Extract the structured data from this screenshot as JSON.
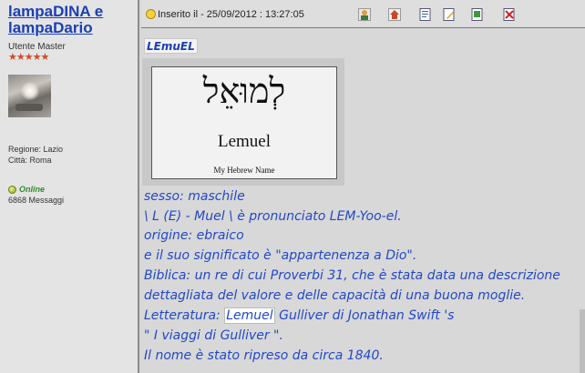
{
  "author": {
    "name": "lampaDINA e lampaDario",
    "rank": "Utente Master",
    "stars": "★★★★★",
    "region_label": "Regione: Lazio",
    "city_label": "Città: Roma",
    "status": "Online",
    "messages": "6868 Messaggi"
  },
  "post": {
    "posted_label": "Inserito il - 25/09/2012 : 13:27:05",
    "toolbar_icons": [
      "profile-icon",
      "home-icon",
      "quote-icon",
      "edit-icon",
      "reply-icon",
      "delete-icon"
    ],
    "name_tag": "LEmuEL",
    "image": {
      "hebrew": "לְמוּאֵל",
      "latin": "Lemuel",
      "caption": "My Hebrew Name"
    },
    "lines": [
      "sesso: maschile",
      "\\ L (E) - Muel \\ è pronunciato LEM-Yoo-el.",
      "origine: ebraico",
      "e il suo significato è \"appartenenza a Dio\".",
      "Biblica: un re di cui Proverbi 31, che è stata data una descrizione",
      "dettagliata del valore e delle capacità di una buona moglie."
    ],
    "lit_prefix": "Letteratura: ",
    "lit_highlight": "Lemuel",
    "lit_suffix": " Gulliver di Jonathan Swift 's",
    "line_gulliver": "\" I viaggi di Gulliver \".",
    "line_last": "Il nome è stato ripreso da circa 1840."
  },
  "colors": {
    "link": "#1a3fb4",
    "body_text": "#2248c8",
    "online": "#2f8a2f"
  }
}
